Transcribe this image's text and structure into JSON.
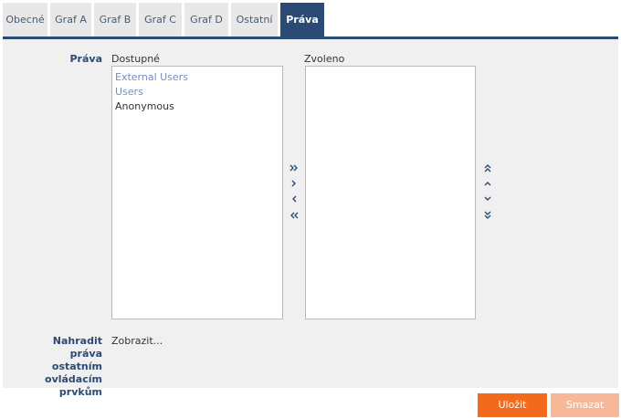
{
  "tabs": [
    {
      "label": "Obecné"
    },
    {
      "label": "Graf A"
    },
    {
      "label": "Graf B"
    },
    {
      "label": "Graf C"
    },
    {
      "label": "Graf D"
    },
    {
      "label": "Ostatní"
    },
    {
      "label": "Práva",
      "active": true
    }
  ],
  "rights": {
    "label": "Práva",
    "available_label": "Dostupné",
    "selected_label": "Zvoleno",
    "available_items": [
      "External Users",
      "Users",
      "Anonymous"
    ],
    "selected_items": []
  },
  "replace": {
    "label_lines": [
      "Nahradit práva",
      "ostatním",
      "ovládacím",
      "prvkům"
    ],
    "link": "Zobrazit..."
  },
  "buttons": {
    "save": "Uložit",
    "delete": "Smazat"
  },
  "colors": {
    "accent": "#2b4a74",
    "primary_button": "#f26b1d",
    "disabled_button": "#f7b899"
  }
}
